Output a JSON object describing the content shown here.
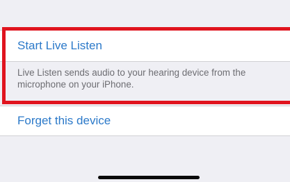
{
  "live_listen": {
    "start_label": "Start Live Listen",
    "footer_text": "Live Listen sends audio to your hearing device from the microphone on your iPhone."
  },
  "device": {
    "forget_label": "Forget this device"
  },
  "colors": {
    "background": "#efeff4",
    "link_blue": "#2b79c9",
    "highlight_red": "#e0141e",
    "footer_gray": "#6d6d72"
  }
}
